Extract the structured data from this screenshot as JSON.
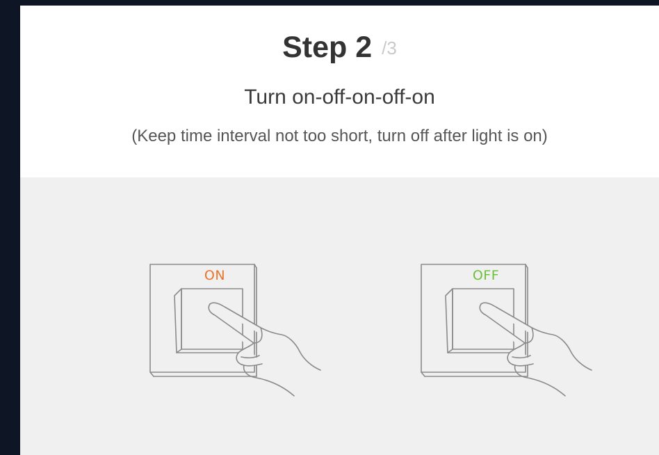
{
  "step": {
    "title": "Step 2",
    "total": "/3"
  },
  "instruction": "Turn on-off-on-off-on",
  "note": "(Keep time interval not too short, turn off after light is on)",
  "switches": [
    {
      "label": "ON",
      "color": "#e8752a"
    },
    {
      "label": "OFF",
      "color": "#6cbf3a"
    }
  ],
  "colors": {
    "background": "#0e1525",
    "panel": "#ffffff",
    "illustration_bg": "#f0f0f0",
    "line": "#8a8a8a"
  }
}
